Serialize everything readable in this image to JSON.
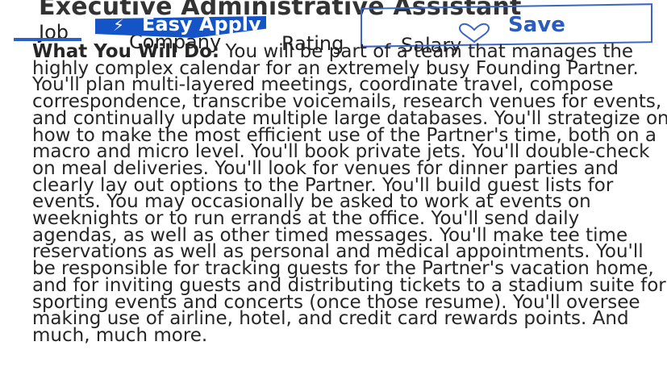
{
  "job": {
    "title": "Executive Administrative Assistant"
  },
  "tabs": {
    "job": "Job",
    "company": "Company",
    "rating": "Rating",
    "salary": "Salary"
  },
  "actions": {
    "easy_apply": "Easy Apply",
    "save": "Save",
    "easy_apply_icon": "lightning-bolt-icon",
    "save_icon": "heart-icon",
    "accent_color": "#1554c7"
  },
  "description": {
    "heading": "What You Will Do:",
    "body": "You will be part of a team that manages the highly complex calendar for an extremely busy Founding Partner. You'll plan multi-layered meetings, coordinate travel, compose correspondence, transcribe voicemails, research venues for events, and continually update multiple large databases. You'll strategize on how to make the most efficient use of the Partner's time, both on a macro and micro level. You'll book private jets. You'll double-check on meal deliveries. You'll look for venues for dinner parties and clearly lay out options to the Partner. You'll build guest lists for events. You may occasionally be asked to work at events on weeknights or to run errands at the office. You'll send daily agendas, as well as other timed messages. You'll make tee time reservations as well as personal and medical appointments. You'll be responsible for tracking guests for the Partner's vacation home, and for inviting guests and distributing tickets to a stadium suite for sporting events and concerts (once those resume). You'll oversee making use of airline, hotel, and credit card rewards points. And much, much more."
  }
}
